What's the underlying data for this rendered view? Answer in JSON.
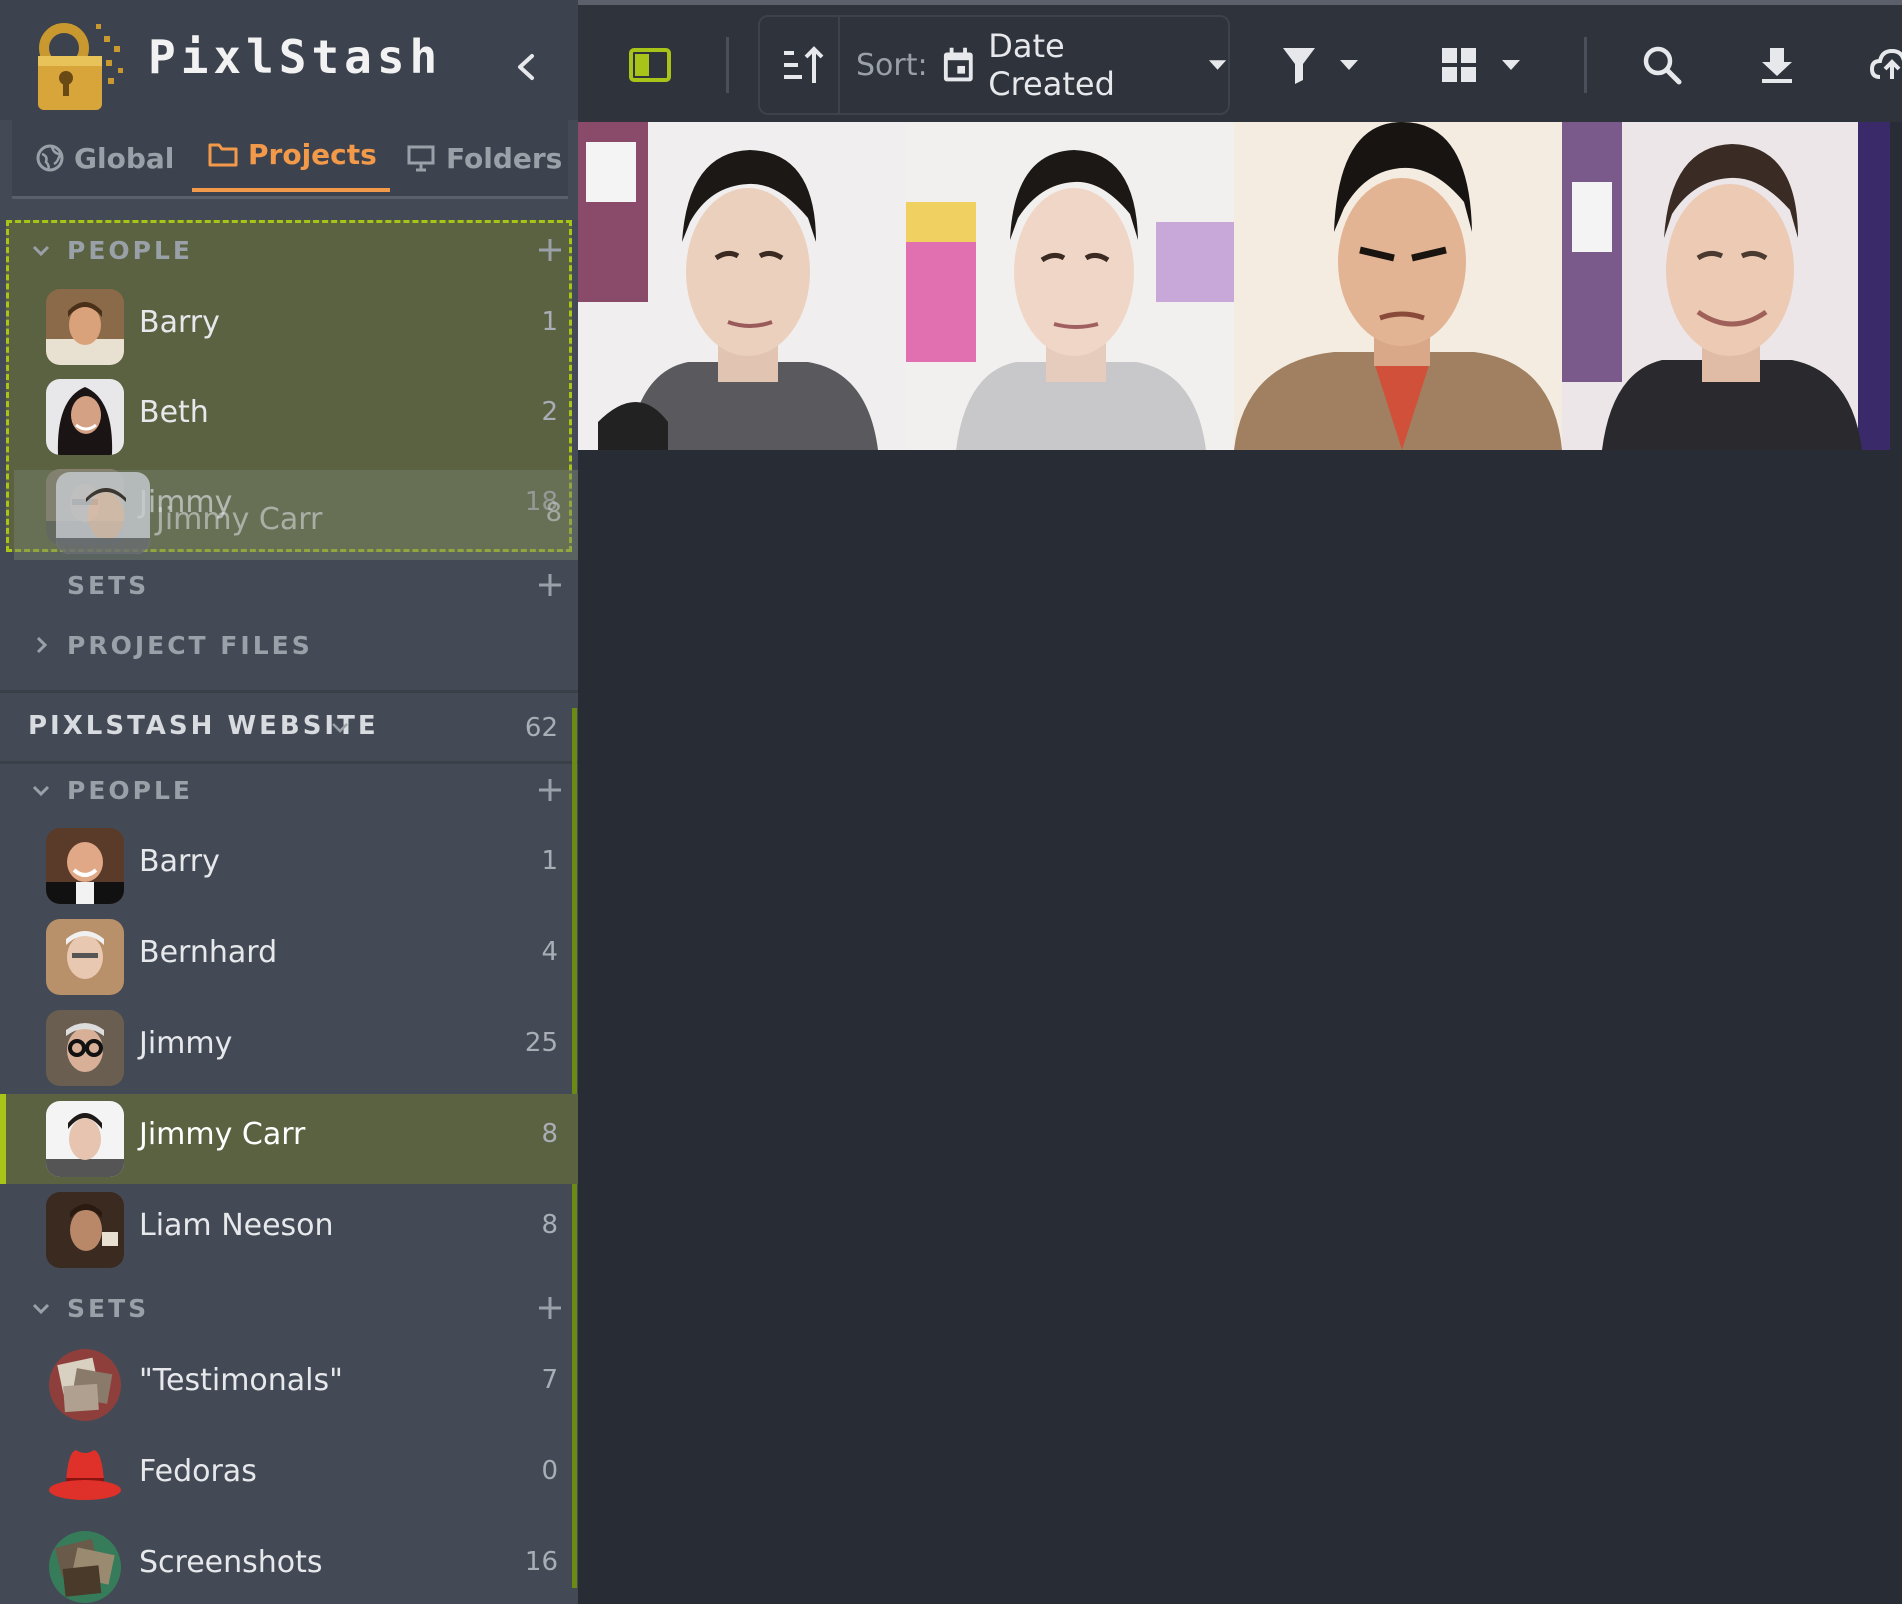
{
  "app": {
    "title": "PixlStash"
  },
  "scope_tabs": [
    {
      "label": "Global",
      "icon": "globe-icon"
    },
    {
      "label": "Projects",
      "icon": "folder-icon"
    },
    {
      "label": "Folders",
      "icon": "monitor-icon"
    }
  ],
  "current_project": {
    "people_header": "PEOPLE",
    "people": [
      {
        "name": "Barry",
        "count": "1"
      },
      {
        "name": "Beth",
        "count": "2"
      },
      {
        "name": "Jimmy",
        "count": "18"
      }
    ],
    "sets_header": "SETS",
    "files_header": "PROJECT FILES"
  },
  "drag_ghost": {
    "name": "Jimmy Carr",
    "count": "8"
  },
  "website_project": {
    "name": "PIXLSTASH WEBSITE",
    "count": "62",
    "people_header": "PEOPLE",
    "people": [
      {
        "name": "Barry",
        "count": "1"
      },
      {
        "name": "Bernhard",
        "count": "4"
      },
      {
        "name": "Jimmy",
        "count": "25"
      },
      {
        "name": "Jimmy Carr",
        "count": "8"
      },
      {
        "name": "Liam Neeson",
        "count": "8"
      }
    ],
    "sets_header": "SETS",
    "sets": [
      {
        "name": "\"Testimonals\"",
        "count": "7"
      },
      {
        "name": "Fedoras",
        "count": "0"
      },
      {
        "name": "Screenshots",
        "count": "16"
      }
    ]
  },
  "toolbar": {
    "sort_prefix": "Sort:",
    "sort_value": "Date Created",
    "icons": [
      "sidebar-toggle-icon",
      "sort-direction-icon",
      "calendar-icon",
      "filter-icon",
      "grid-icon",
      "search-icon",
      "download-icon",
      "upload-icon"
    ]
  },
  "colors": {
    "accent_orange": "#f2994a",
    "accent_green": "#a8c418",
    "selection_bg": "#5a6241",
    "sidebar_bg": "#444a55",
    "main_bg": "#282c34"
  }
}
